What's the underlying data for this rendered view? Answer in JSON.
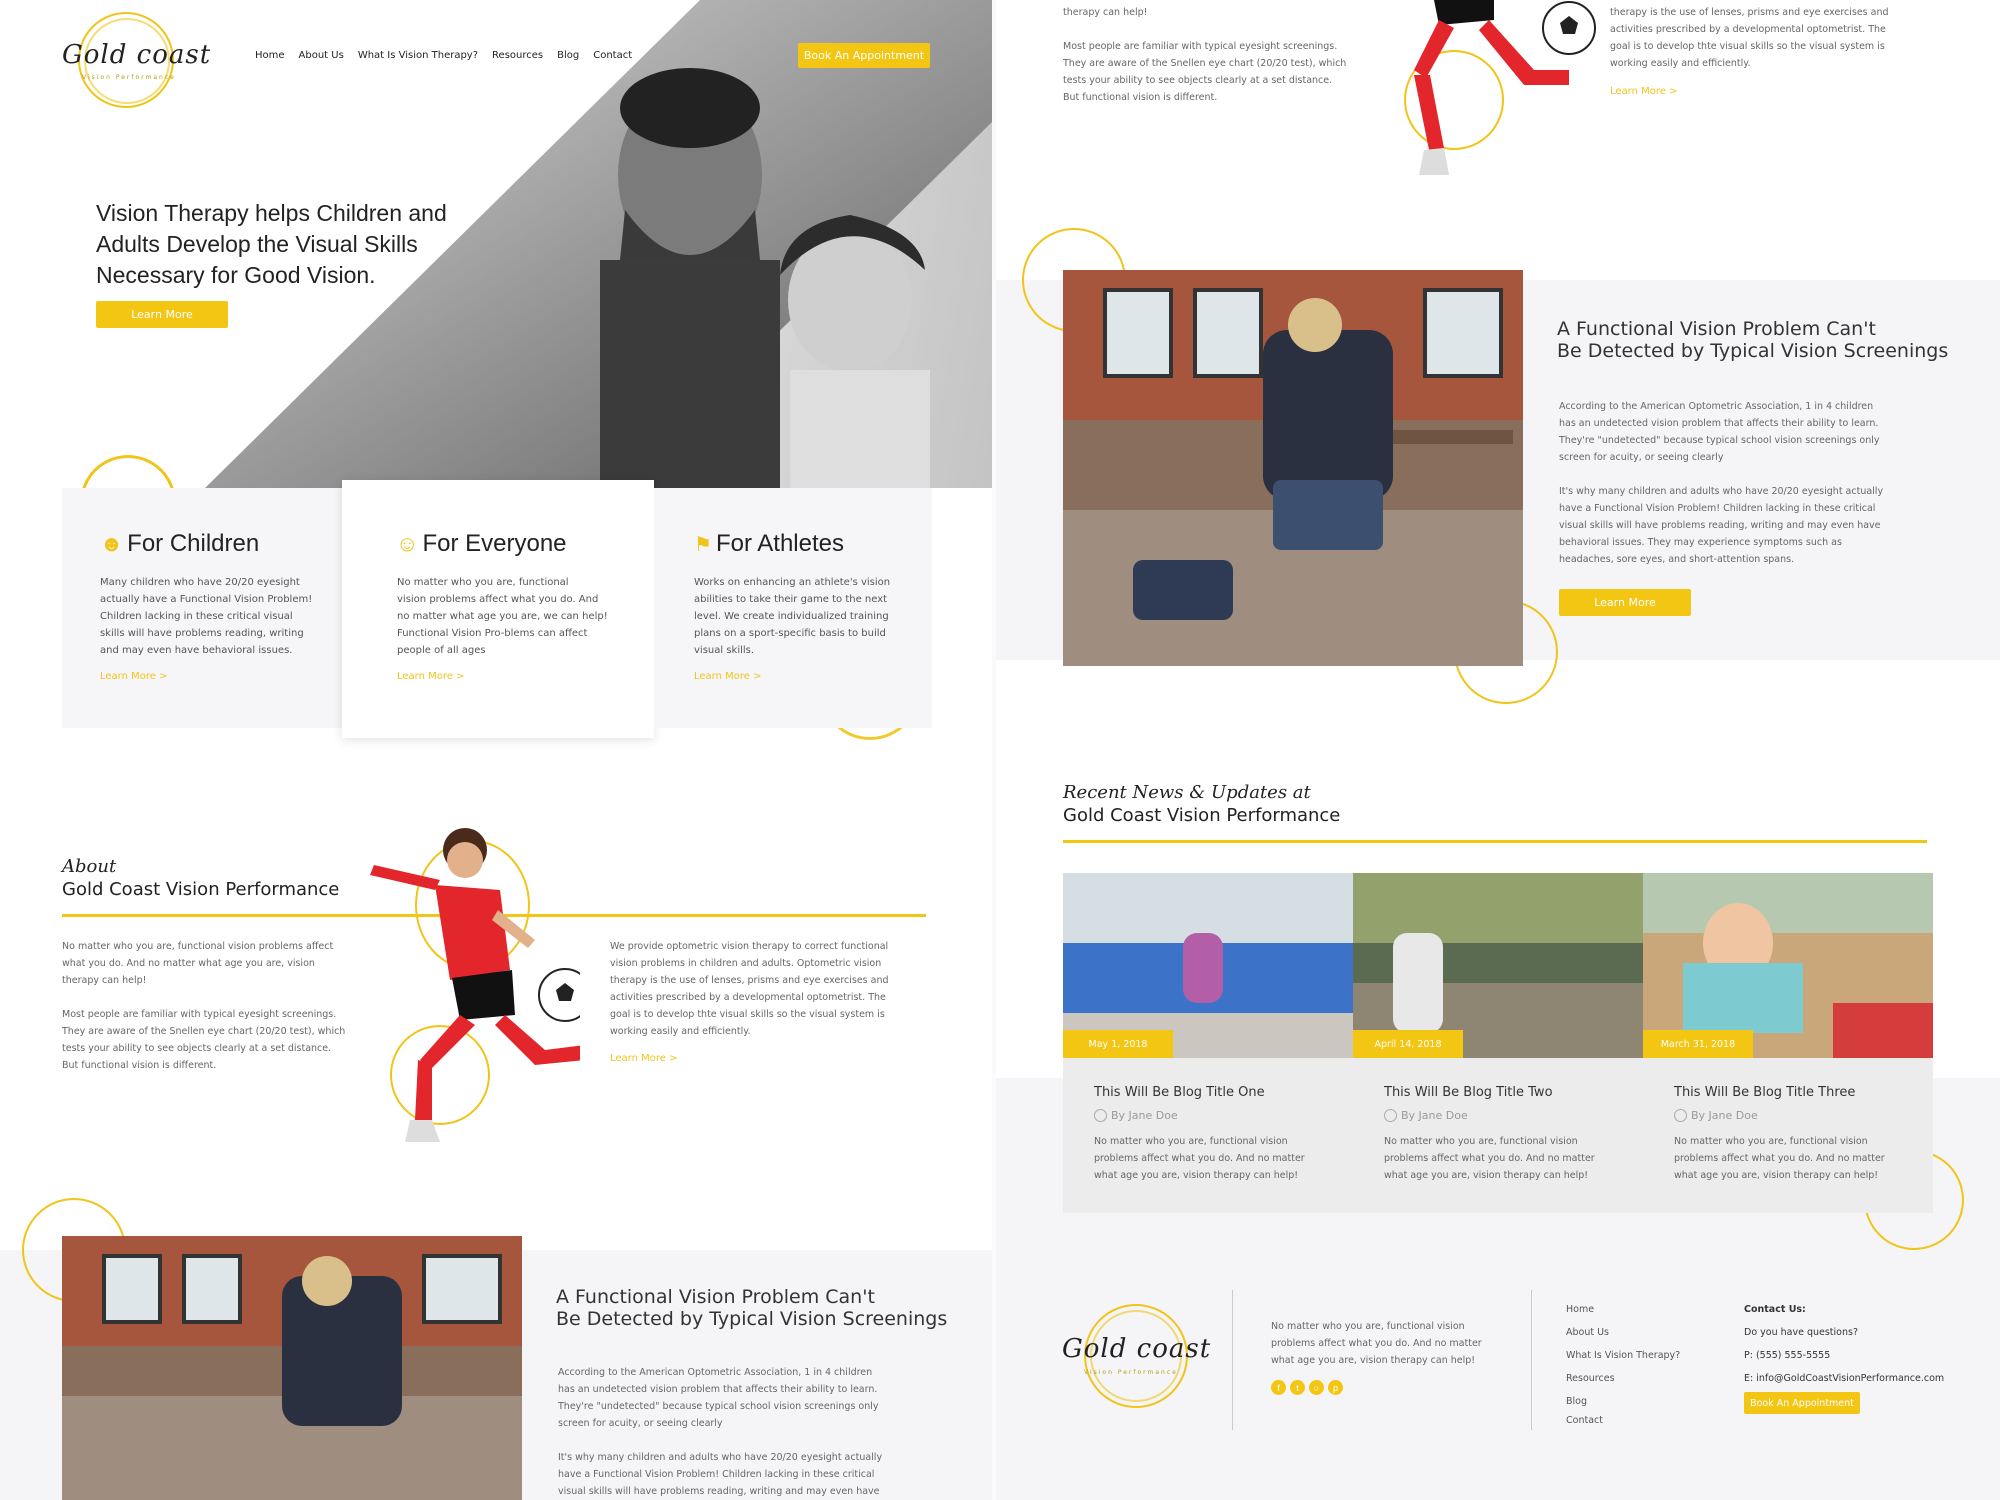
{
  "logo": {
    "text": "Gold coast",
    "sub": "Vision Performance"
  },
  "nav": {
    "items": [
      "Home",
      "About Us",
      "What Is Vision Therapy?",
      "Resources",
      "Blog",
      "Contact"
    ],
    "cta": "Book An Appointment"
  },
  "hero": {
    "title_1": "Vision Therapy helps Children and",
    "title_2": "Adults Develop the Visual Skills",
    "title_3": "Necessary for Good Vision.",
    "button": "Learn More"
  },
  "cards": [
    {
      "title": "For Children",
      "lines": [
        "Many children who have 20/20 eyesight",
        "actually have a Functional Vision Problem!",
        "Children lacking in these critical visual",
        "skills will have problems reading, writing",
        "and may even have behavioral issues."
      ],
      "link": "Learn More >"
    },
    {
      "title": "For Everyone",
      "lines": [
        "No matter who you are, functional",
        "vision problems affect what you do.  And",
        "no matter what age you are, we can help!",
        "Functional Vision Pro-blems can affect",
        "people of all ages"
      ],
      "link": "Learn More >"
    },
    {
      "title": "For Athletes",
      "lines": [
        "Works on enhancing an athlete's vision",
        "abilities to take their game to the next",
        "level. We create individualized training",
        "plans on a sport-specific basis to build",
        "visual skills."
      ],
      "link": "Learn More >"
    }
  ],
  "about": {
    "title_italic": "About",
    "title_bold": "Gold Coast Vision Performance",
    "left_p1": [
      "No matter who you are, functional vision problems affect",
      "what you do.  And no matter what age you are, vision",
      "therapy can help!"
    ],
    "left_p2": [
      "Most people are familiar with typical eyesight screenings.",
      "They are aware of the Snellen eye chart (20/20 test), which",
      "tests your ability to see objects clearly at a set distance.",
      "But functional vision is different."
    ],
    "right_p": [
      "We provide optometric vision therapy to correct functional",
      "vision problems in children and adults. Optometric vision",
      "therapy is the use of lenses, prisms and eye exercises and",
      "activities prescribed by a developmental optometrist. The",
      "goal is to develop thte visual skills so the visual system is",
      "working easily and efficiently."
    ],
    "link": "Learn More >"
  },
  "top_right": {
    "left_lines_a": [
      "therapy can help!"
    ],
    "left_lines_b": [
      "Most people are familiar with typical eyesight screenings.",
      "They are aware of the Snellen eye chart (20/20 test), which",
      "tests your ability to see objects clearly at a set distance.",
      "But functional vision is different."
    ],
    "right_lines": [
      "therapy is the use of lenses, prisms and eye exercises and",
      "activities prescribed by a developmental optometrist. The",
      "goal is to develop thte visual skills so the visual system is",
      "working easily and efficiently."
    ],
    "link": "Learn More >"
  },
  "problem": {
    "title_1": "A Functional Vision Problem Can't",
    "title_2": "Be Detected by Typical Vision Screenings",
    "p1": [
      "According to the American Optometric Association, 1 in 4 children",
      "has an undetected vision problem that affects their ability to learn.",
      "They're \"undetected\" because typical school vision screenings only",
      "screen for acuity, or seeing clearly"
    ],
    "p2": [
      "It's why many children and adults who have 20/20 eyesight actually",
      "have a Functional Vision Problem! Children lacking in these critical",
      "visual skills will have problems reading, writing and may even have",
      "behavioral issues. They may experience symptoms such as",
      "headaches, sore eyes, and short-attention spans."
    ],
    "button": "Learn More"
  },
  "news": {
    "title_italic": "Recent News & Updates at",
    "title_bold": "Gold Coast Vision Performance",
    "posts": [
      {
        "date": "May 1, 2018",
        "title": "This Will Be Blog Title One",
        "author": "By Jane Doe",
        "lines": [
          "No matter who you are, functional vision",
          "problems affect what you do. And no matter",
          "what age you are, vision therapy can help!"
        ]
      },
      {
        "date": "April 14, 2018",
        "title": "This Will Be Blog Title Two",
        "author": "By Jane Doe",
        "lines": [
          "No matter who you are, functional vision",
          "problems affect what you do. And no matter",
          "what age you are, vision therapy can help!"
        ]
      },
      {
        "date": "March 31, 2018",
        "title": "This Will Be Blog Title Three",
        "author": "By Jane Doe",
        "lines": [
          "No matter who you are, functional vision",
          "problems affect what you do. And no matter",
          "what age you are, vision therapy can help!"
        ]
      }
    ]
  },
  "footer": {
    "about_lines": [
      "No matter who you are, functional vision",
      "problems affect what you do. And no matter",
      "what age you are, vision therapy can help!"
    ],
    "links": [
      "Home",
      "About Us",
      "What Is Vision Therapy?",
      "Resources",
      "Blog",
      "Contact"
    ],
    "contact_title": "Contact Us:",
    "contact_q": "Do you have questions?",
    "phone": "P: (555) 555-5555",
    "email": "E: info@GoldCoastVisionPerformance.com",
    "cta": "Book An Appointment",
    "social_icons": [
      "facebook-icon",
      "twitter-icon",
      "instagram-icon",
      "pinterest-icon"
    ]
  },
  "colors": {
    "accent": "#f3c614",
    "panel": "#f5f5f7"
  }
}
